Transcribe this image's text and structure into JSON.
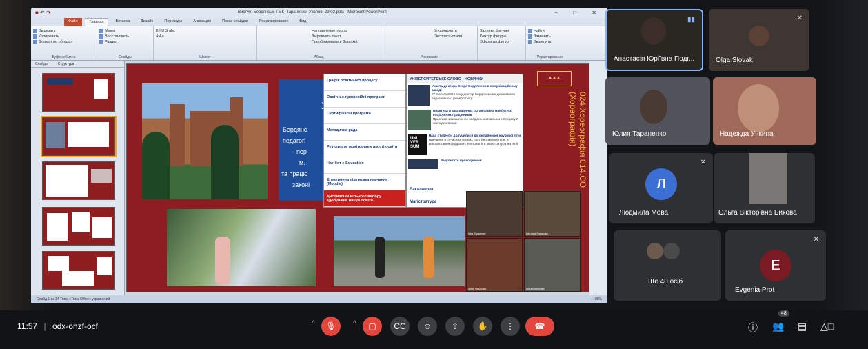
{
  "powerpoint": {
    "title": "Виступ_Бердянськ_ГМК_Тараненко_Уколов_29.02.pptx - Microsoft PowerPoint",
    "tabs": [
      "Файл",
      "Главная",
      "Вставка",
      "Дизайн",
      "Переходы",
      "Анимация",
      "Показ слайдов",
      "Рецензирование",
      "Вид"
    ],
    "ribbon_groups": [
      {
        "label": "Буфер обмена",
        "items": [
          "Вырезать",
          "Копировать",
          "Формат по образцу"
        ]
      },
      {
        "label": "Слайды",
        "items": [
          "Макет",
          "Восстановить",
          "Раздел"
        ]
      },
      {
        "label": "Шрифт",
        "items": [
          "B  I  U  S  abc",
          "A  Аа"
        ]
      },
      {
        "label": "Абзац",
        "items": [
          "Направление текста",
          "Выровнять текст",
          "Преобразовать в SmartArt"
        ]
      },
      {
        "label": "Рисование",
        "items": [
          "Упорядочить",
          "Экспресс-стили"
        ]
      },
      {
        "label": "Редактирование",
        "items": [
          "Найти",
          "Заменить",
          "Выделить"
        ]
      },
      {
        "label": "",
        "items": [
          "Заливка фигуры",
          "Контур фигуры",
          "Эффекты фигур"
        ]
      }
    ],
    "left_tabs": [
      "Слайды",
      "Структура"
    ],
    "status_left": "Слайд 1 из 14    Тема «Тема Office»    украинский",
    "status_right": "108%"
  },
  "slide": {
    "blue_text": [
      "Бердянс",
      "педагогі",
      "пер",
      "м.",
      "та працю",
      "законі"
    ],
    "letter_u": "У",
    "menu_items": [
      "Графік освітнього процесу",
      "Освітньо-професійні програми",
      "Сертифікатні програми",
      "Методична рада",
      "Результати моніторингу якості освіти",
      "Чат-бот e-Education",
      "Електронна підтримка навчання (Moodle)",
      "Дисципліни вільного вибору здобувачів вищої освіти"
    ],
    "news_header": "УНІВЕРСИТЕТСЬКЕ СЛОВО - НОВИНКИ",
    "news": [
      {
        "title": "Участь доктора Егора Бердянова в комунікаційному заході",
        "text": "27 лютого 2024 року доктор Бердянського державного педагогічного університету..."
      },
      {
        "title": "Практика в закордонних організаціях майбутніх соціальних працівників",
        "text": "Практика з визначених засідань навчального процесу в закладах вищої"
      },
      {
        "title": "Наші студенти долучилися до онлайнової наукової літи",
        "text": "Навчання в сучасних умовах постійно змінюється, а використання цифрових технологій в магістратура на лінії"
      },
      {
        "title": "Результати проходження",
        "text": ""
      }
    ],
    "news_bottom": [
      "Бакалаврат",
      "Магістратура"
    ],
    "vertical_text": "024 Хореографія 014.СО (Хореографія)",
    "gallery_labels": [
      "Юля Тараненко",
      "Світлана Романова",
      "Ірина Федорова",
      "Анна Ковальова"
    ]
  },
  "participants": [
    {
      "name": "Анастасія Юріївна Подг...",
      "type": "video",
      "active": true
    },
    {
      "name": "Olga Slovak",
      "type": "video"
    },
    {
      "name": "Юлия Тараненко",
      "type": "video"
    },
    {
      "name": "Надежда Учкина",
      "type": "video"
    },
    {
      "name": "Людмила Мова",
      "type": "avatar",
      "initial": "Л",
      "color": "#3b6fd4"
    },
    {
      "name": "Ольга Вікторівна Бикова",
      "type": "video"
    },
    {
      "name": "Ще 40 осіб",
      "type": "more"
    },
    {
      "name": "Evgenia Prot",
      "type": "avatar",
      "initial": "E",
      "color": "#7a1b24"
    }
  ],
  "bottom_bar": {
    "time": "11:57",
    "separator": "|",
    "meeting_code": "odx-onzf-ocf",
    "participant_count": "48"
  },
  "icons": {
    "mic_off": "mic-off-icon",
    "cam_off": "camera-off-icon",
    "captions": "captions-icon",
    "emoji": "emoji-icon",
    "present": "present-icon",
    "hand": "raise-hand-icon",
    "more": "more-icon",
    "end": "end-call-icon",
    "info": "info-icon",
    "people": "people-icon",
    "chat": "chat-icon",
    "activities": "activities-icon"
  }
}
